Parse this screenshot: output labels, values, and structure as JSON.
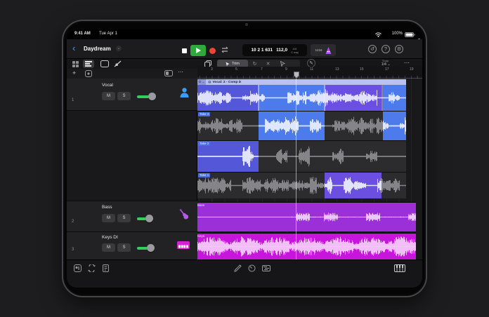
{
  "statusbar": {
    "time": "9:41 AM",
    "date": "Tue Apr 1",
    "battery": "100%"
  },
  "toolbar": {
    "title": "Daydream",
    "lcd_position": "10 2 1 631",
    "lcd_tempo": "112,0",
    "lcd_timesig": "4/4",
    "lcd_key": "C maj",
    "countin": "1234"
  },
  "toolrow": {
    "trim_label": "Trim",
    "snap_label": "Snap",
    "snap_value": "1/4"
  },
  "ruler": {
    "bars": [
      "3",
      "5",
      "7",
      "9",
      "11",
      "13",
      "15",
      "17",
      "19"
    ]
  },
  "tracks": [
    {
      "num": "1",
      "name": "Vocal",
      "mute": "M",
      "solo": "S"
    },
    {
      "num": "2",
      "name": "Bass",
      "mute": "M",
      "solo": "S"
    },
    {
      "num": "3",
      "name": "Keys DI",
      "mute": "M",
      "solo": "S"
    }
  ],
  "regions": {
    "comp_chip": "D",
    "comp_title": "Vocal: 2 - Comp D",
    "take_labels": [
      "Take 3",
      "Take 2",
      "Take 1"
    ],
    "bass_label": "Bass",
    "keys_label": "Keys"
  },
  "colors": {
    "comp_indigo": "#5457d8",
    "comp_blue": "#4d7bec",
    "comp_purple": "#6a4fe0",
    "bass": "#9b2fd8",
    "keys": "#c716dc",
    "play_green": "#2fa93c",
    "record_red": "#ed4639",
    "accent_blue": "#409cff"
  }
}
